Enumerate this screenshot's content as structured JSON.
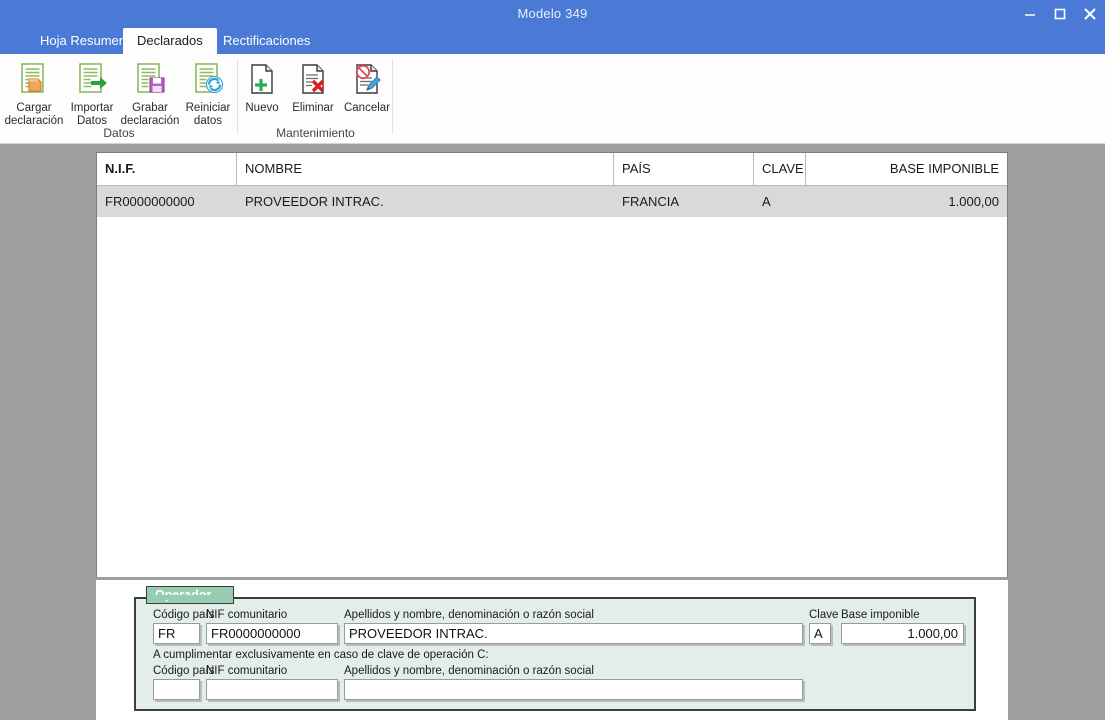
{
  "window": {
    "title": "Modelo 349",
    "controls": [
      {
        "name": "minimize-button",
        "glyph": "minimize"
      },
      {
        "name": "maximize-button",
        "glyph": "maximize"
      },
      {
        "name": "close-button",
        "glyph": "close"
      }
    ],
    "accent_color": "#4a7ad6"
  },
  "tabs": [
    {
      "label": "Hoja Resumen",
      "active": false
    },
    {
      "label": "Declarados",
      "active": true
    },
    {
      "label": "Rectificaciones",
      "active": false
    }
  ],
  "ribbon": {
    "groups": [
      {
        "label": "Datos",
        "buttons": [
          {
            "label": "Cargar\ndeclaración",
            "icon": "document-folder-icon"
          },
          {
            "label": "Importar\nDatos",
            "icon": "document-import-arrow-icon"
          },
          {
            "label": "Grabar\ndeclaración",
            "icon": "document-save-floppy-icon"
          },
          {
            "label": "Reiniciar\ndatos",
            "icon": "document-refresh-icon"
          }
        ]
      },
      {
        "label": "Mantenimiento",
        "buttons": [
          {
            "label": "Nuevo",
            "icon": "page-plus-icon"
          },
          {
            "label": "Eliminar",
            "icon": "page-delete-icon"
          },
          {
            "label": "Cancelar",
            "icon": "page-cancel-pencil-icon"
          }
        ]
      }
    ]
  },
  "grid": {
    "columns": [
      {
        "key": "nif",
        "header": "N.I.F.",
        "align": "left",
        "bold": true
      },
      {
        "key": "nombre",
        "header": "NOMBRE",
        "align": "left",
        "bold": false
      },
      {
        "key": "pais",
        "header": "PAÍS",
        "align": "left",
        "bold": false
      },
      {
        "key": "clave",
        "header": "CLAVE",
        "align": "left",
        "bold": false
      },
      {
        "key": "base",
        "header": "BASE IMPONIBLE",
        "align": "right",
        "bold": false
      }
    ],
    "rows": [
      {
        "nif": "FR0000000000",
        "nombre": "PROVEEDOR INTRAC.",
        "pais": "FRANCIA",
        "clave": "A",
        "base": "1.000,00",
        "selected": true
      }
    ]
  },
  "form": {
    "title": "Operador",
    "note": "A cumplimentar exclusivamente en caso de clave de operación C:",
    "labels": {
      "codigo_pais": "Código país",
      "nif_comunitario": "NIF comunitario",
      "apellidos": "Apellidos y nombre, denominación o razón social",
      "clave": "Clave",
      "base_imponible": "Base imponible"
    },
    "primary": {
      "codigo_pais": "FR",
      "nif_comunitario": "FR0000000000",
      "apellidos": "PROVEEDOR INTRAC.",
      "clave": "A",
      "base_imponible": "1.000,00"
    },
    "secondary": {
      "codigo_pais": "",
      "nif_comunitario": "",
      "apellidos": ""
    }
  }
}
